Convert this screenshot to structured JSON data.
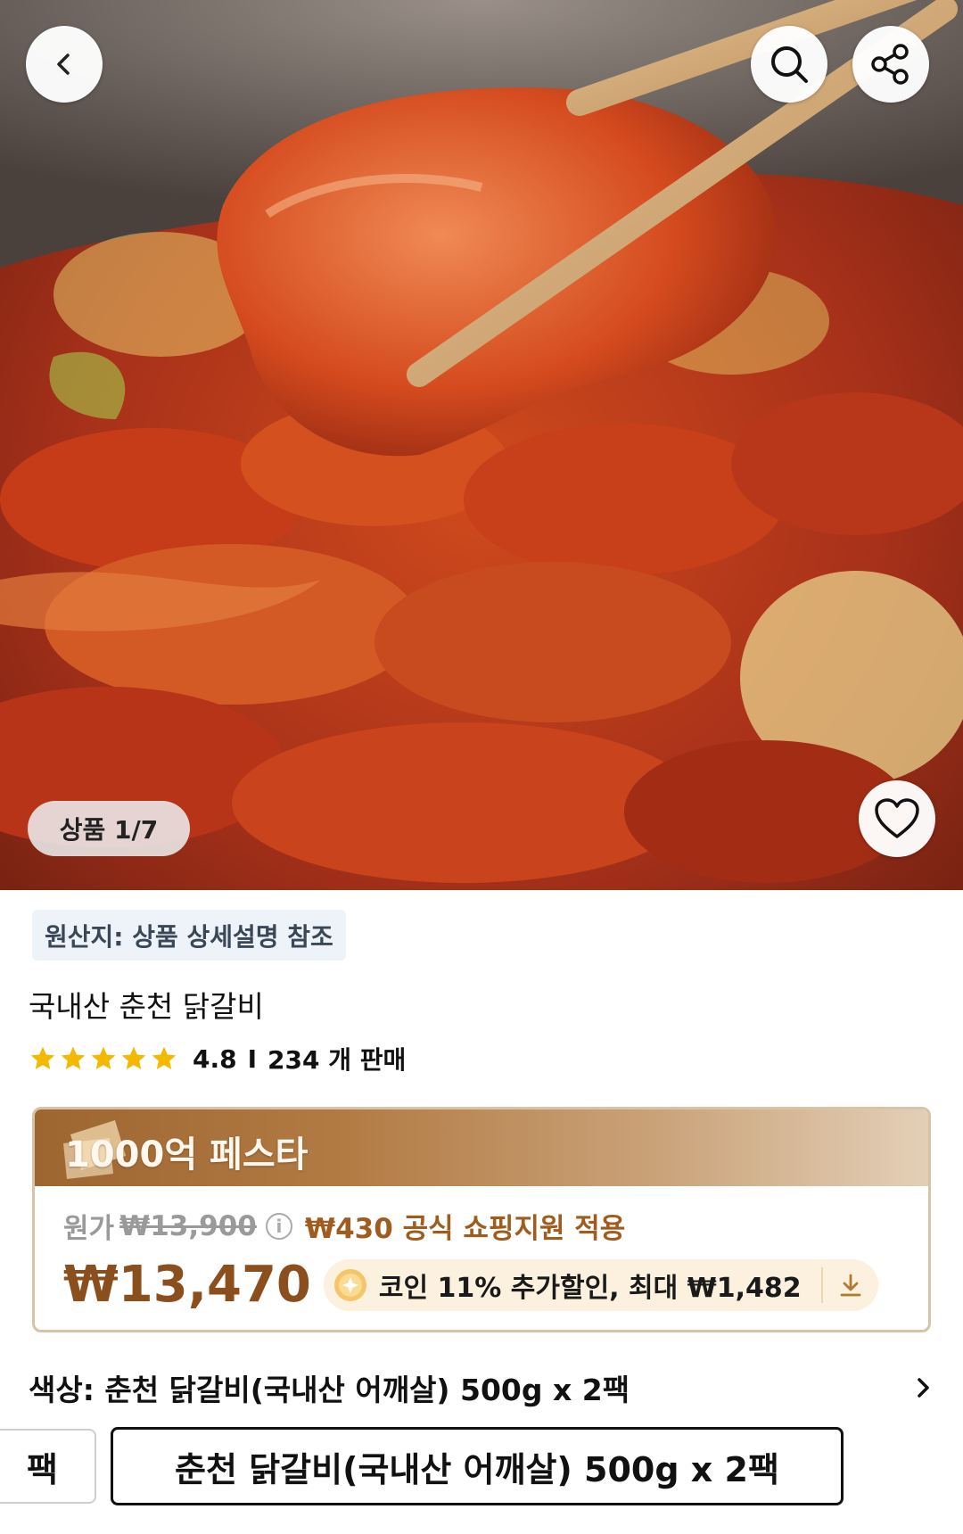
{
  "hero": {
    "photo_counter": "상품 1/7",
    "buttons": {
      "back": "chevron-left-icon",
      "search": "search-icon",
      "share": "share-icon",
      "wishlist": "heart-icon"
    }
  },
  "product": {
    "origin_badge": "원산지: 상품 상세설명 참조",
    "title": "국내산 춘천 닭갈비",
    "rating": "4.8",
    "rating_separator": "I",
    "sold": "234 개 판매",
    "stars_filled": 5
  },
  "promo": {
    "title": "1000억 페스타",
    "original_label": "원가",
    "original_price": "₩13,900",
    "info_icon": "i",
    "support_text": "₩430 공식 쇼핑지원 적용",
    "sale_price": "₩13,470",
    "coin_text": "코인 11% 추가할인, 최대 ₩1,482",
    "colors": {
      "header_start": "#9d6530",
      "header_end": "#e3cfb7",
      "sale_price": "#8a4f1c",
      "support_text": "#a05c1e"
    }
  },
  "option": {
    "label": "색상: 춘천 닭갈비(국내산 어깨살) 500g x 2팩",
    "prev_chip": "팩",
    "selected_chip": "춘천 닭갈비(국내산 어깨살) 500g x 2팩"
  }
}
